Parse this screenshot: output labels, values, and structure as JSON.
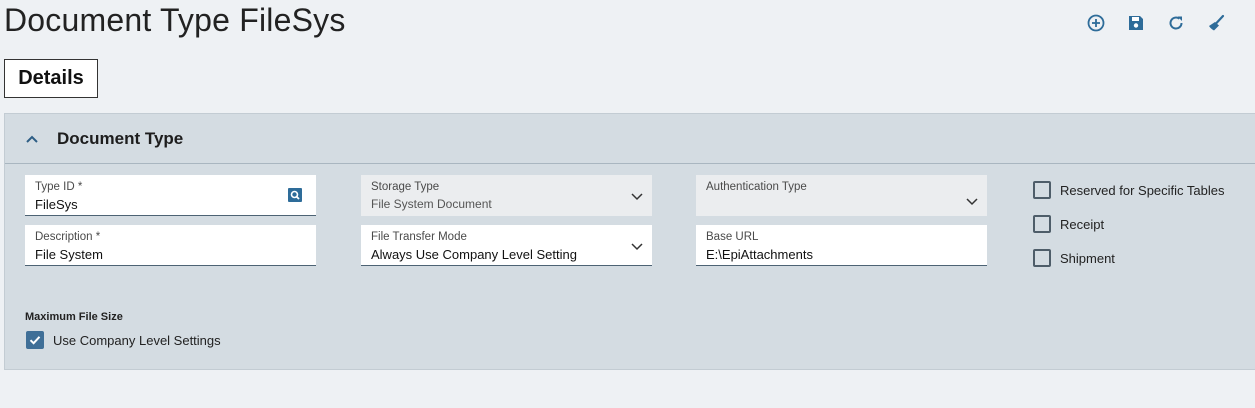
{
  "page": {
    "title": "Document Type FileSys"
  },
  "toolbar": {
    "icons": [
      "add-new-icon",
      "save-icon",
      "refresh-icon",
      "clear-icon"
    ],
    "accent_color": "#2e6c99"
  },
  "tabs": [
    {
      "label": "Details"
    }
  ],
  "section": {
    "title": "Document Type",
    "fields": {
      "type_id": {
        "label": "Type ID *",
        "value": "FileSys"
      },
      "storage_type": {
        "label": "Storage Type",
        "value": "File System Document"
      },
      "authentication_type": {
        "label": "Authentication Type",
        "value": ""
      },
      "description": {
        "label": "Description *",
        "value": "File System"
      },
      "file_transfer_mode": {
        "label": "File Transfer Mode",
        "value": "Always Use Company Level Setting"
      },
      "base_url": {
        "label": "Base URL",
        "value": "E:\\EpiAttachments"
      }
    },
    "checkboxes": [
      {
        "label": "Reserved for Specific Tables",
        "checked": false
      },
      {
        "label": "Receipt",
        "checked": false
      },
      {
        "label": "Shipment",
        "checked": false
      }
    ],
    "max_file_size": {
      "label": "Maximum File Size",
      "use_company_label": "Use Company Level Settings",
      "use_company_checked": true
    }
  }
}
